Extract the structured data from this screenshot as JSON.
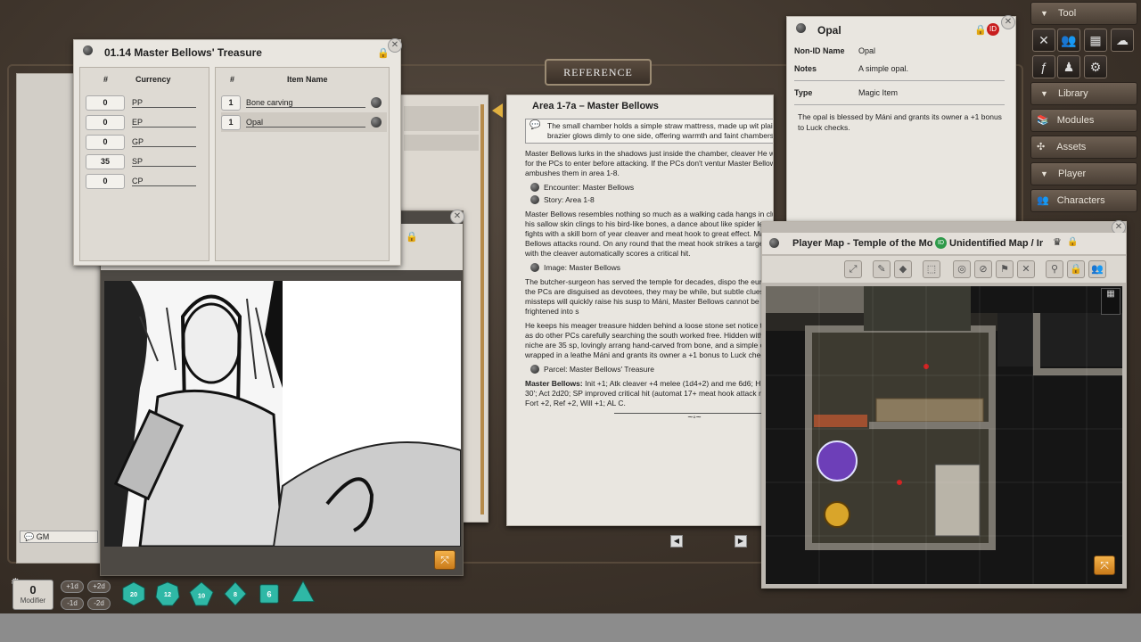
{
  "treasure": {
    "title": "01.14 Master Bellows' Treasure",
    "currency_headers": [
      "#",
      "Currency"
    ],
    "currency": [
      {
        "amount": "0",
        "name": "PP"
      },
      {
        "amount": "0",
        "name": "EP"
      },
      {
        "amount": "0",
        "name": "GP"
      },
      {
        "amount": "35",
        "name": "SP"
      },
      {
        "amount": "0",
        "name": "CP"
      }
    ],
    "item_headers": [
      "#",
      "Item Name"
    ],
    "items": [
      {
        "count": "1",
        "name": "Bone carving"
      },
      {
        "count": "1",
        "name": "Opal"
      }
    ]
  },
  "reference_label": "REFERENCE",
  "story": {
    "title": "Area 1-7a – Master Bellows",
    "boxed": "The small chamber holds a simple straw mattress, made up wit plain brazier glows dimly to one side, offering warmth and faint chambers.",
    "p1": "Master Bellows lurks in the shadows just inside the chamber, cleaver He waits for the PCs to enter before attacking. If the PCs don't ventur Master Bellows ambushes them in area 1-8.",
    "link_encounter": "Encounter: Master Bellows",
    "link_story": "Story: Area 1-8",
    "p2": "Master Bellows resembles nothing so much as a walking cada hangs in clumps, his sallow skin clings to his bird-like bones, a dance about like spider legs. He fights with a skill born of year cleaver and meat hook to great effect. Master Bellows attacks round. On any round that the meat hook strikes a target on a with the cleaver automatically scores a critical hit.",
    "link_image": "Image: Master Bellows",
    "p3": "The butcher-surgeon has served the temple for decades, dispo the eunuchs. If the PCs are disguised as devotees, they may be while, but subtle clues and missteps will quickly raise his susp to Máni, Master Bellows cannot be bribed or frightened into s",
    "p4": "He keeps his meager treasure hidden behind a loose stone set notice the stone as do other PCs carefully searching the south worked free. Hidden within the niche are 35 sp, lovingly arrang hand-carved from bone, and a simple opal wrapped in a leathe Máni and grants its owner a +1 bonus to Luck checks.",
    "link_parcel": "Parcel: Master Bellows' Treasure",
    "stat_name": "Master Bellows:",
    "stat_text": "Init +1; Atk cleaver +4 melee (1d4+2) and me 6d6; HP 24; MV 30'; Act 2d20; SP improved critical hit (automat 17+ meat hook attack roll); SV Fort +2, Ref +2, Will +1; AL C."
  },
  "item": {
    "title": "Opal",
    "nonid_label": "Non-ID Name",
    "nonid_value": "Opal",
    "notes_label": "Notes",
    "notes_value": "A simple opal.",
    "type_label": "Type",
    "type_value": "Magic Item",
    "description": "The opal is blessed by Máni and grants its owner a +1 bonus to Luck checks."
  },
  "map": {
    "title": "Player Map - Temple of the Mo",
    "unidentified": "Unidentified Map / Ir"
  },
  "chat": {
    "gm_label": "GM"
  },
  "dice": {
    "modifier_value": "0",
    "modifier_label": "Modifier",
    "mod_buttons": [
      "+1d",
      "+2d",
      "-1d",
      "-2d"
    ],
    "dice": [
      "20",
      "12",
      "10",
      "8",
      "6",
      ""
    ]
  },
  "sidebar": {
    "tool_header": "Tool",
    "library_header": "Library",
    "modules": "Modules",
    "assets": "Assets",
    "player_header": "Player",
    "characters": "Characters"
  },
  "colors": {
    "accent_teal": "#2fb8a6",
    "lock_red": "#8a1010",
    "desk_brown": "#3e342b"
  }
}
